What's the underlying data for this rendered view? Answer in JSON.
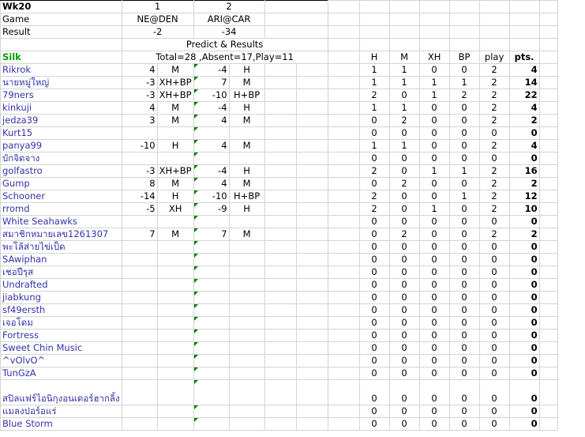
{
  "sheet": {
    "week": "Wk20",
    "labels": {
      "game": "Game",
      "result": "Result",
      "predict": "Predict & Results"
    },
    "games": [
      {
        "num": "1",
        "matchup": "NE@DEN",
        "result": "-2"
      },
      {
        "num": "2",
        "matchup": "ARI@CAR",
        "result": "-34"
      }
    ],
    "group": {
      "name": "Silk",
      "summary": "Total=28 ,Absent=17,Play=11"
    },
    "columns": [
      "H",
      "M",
      "XH",
      "BP",
      "play",
      "pts."
    ],
    "players": [
      {
        "name": "Rikrok",
        "p1": "4",
        "r1": "M",
        "p2": "-4",
        "r2": "H",
        "H": "1",
        "M": "1",
        "XH": "0",
        "BP": "0",
        "play": "2",
        "pts": "4"
      },
      {
        "name": "นายหมู่ใหญ่",
        "p1": "-3",
        "r1": "XH+BP",
        "p2": "7",
        "r2": "M",
        "H": "1",
        "M": "1",
        "XH": "1",
        "BP": "1",
        "play": "2",
        "pts": "14"
      },
      {
        "name": "79ners",
        "p1": "-3",
        "r1": "XH+BP",
        "p2": "-10",
        "r2": "H+BP",
        "H": "2",
        "M": "0",
        "XH": "1",
        "BP": "2",
        "play": "2",
        "pts": "22"
      },
      {
        "name": "kinkuji",
        "p1": "4",
        "r1": "M",
        "p2": "-4",
        "r2": "H",
        "H": "1",
        "M": "1",
        "XH": "0",
        "BP": "0",
        "play": "2",
        "pts": "4"
      },
      {
        "name": "jedza39",
        "p1": "3",
        "r1": "M",
        "p2": "4",
        "r2": "M",
        "H": "0",
        "M": "2",
        "XH": "0",
        "BP": "0",
        "play": "2",
        "pts": "2"
      },
      {
        "name": "Kurt15",
        "p1": "",
        "r1": "",
        "p2": "",
        "r2": "",
        "H": "0",
        "M": "0",
        "XH": "0",
        "BP": "0",
        "play": "0",
        "pts": "0"
      },
      {
        "name": "panya99",
        "p1": "-10",
        "r1": "H",
        "p2": "4",
        "r2": "M",
        "H": "1",
        "M": "1",
        "XH": "0",
        "BP": "0",
        "play": "2",
        "pts": "4"
      },
      {
        "name": "บักจิดจาง",
        "p1": "",
        "r1": "",
        "p2": "",
        "r2": "",
        "H": "0",
        "M": "0",
        "XH": "0",
        "BP": "0",
        "play": "0",
        "pts": "0"
      },
      {
        "name": "golfastro",
        "p1": "-3",
        "r1": "XH+BP",
        "p2": "-4",
        "r2": "H",
        "H": "2",
        "M": "0",
        "XH": "1",
        "BP": "1",
        "play": "2",
        "pts": "16"
      },
      {
        "name": "Gump",
        "p1": "8",
        "r1": "M",
        "p2": "4",
        "r2": "M",
        "H": "0",
        "M": "2",
        "XH": "0",
        "BP": "0",
        "play": "2",
        "pts": "2"
      },
      {
        "name": "Schooner",
        "p1": "-14",
        "r1": "H",
        "p2": "-10",
        "r2": "H+BP",
        "H": "2",
        "M": "0",
        "XH": "0",
        "BP": "1",
        "play": "2",
        "pts": "12"
      },
      {
        "name": "rromd",
        "p1": "-5",
        "r1": "XH",
        "p2": "-9",
        "r2": "H",
        "H": "2",
        "M": "0",
        "XH": "1",
        "BP": "0",
        "play": "2",
        "pts": "10"
      },
      {
        "name": "White Seahawks",
        "p1": "",
        "r1": "",
        "p2": "",
        "r2": "",
        "H": "0",
        "M": "0",
        "XH": "0",
        "BP": "0",
        "play": "0",
        "pts": "0"
      },
      {
        "name": "สมาชิกหมายเลข1261307",
        "p1": "7",
        "r1": "M",
        "p2": "7",
        "r2": "M",
        "H": "0",
        "M": "2",
        "XH": "0",
        "BP": "0",
        "play": "2",
        "pts": "2"
      },
      {
        "name": "พะโล้ส่ายไข่เป็ด",
        "p1": "",
        "r1": "",
        "p2": "",
        "r2": "",
        "H": "0",
        "M": "0",
        "XH": "0",
        "BP": "0",
        "play": "0",
        "pts": "0"
      },
      {
        "name": "SAwiphan",
        "p1": "",
        "r1": "",
        "p2": "",
        "r2": "",
        "H": "0",
        "M": "0",
        "XH": "0",
        "BP": "0",
        "play": "0",
        "pts": "0"
      },
      {
        "name": "เชอปีรุส",
        "p1": "",
        "r1": "",
        "p2": "",
        "r2": "",
        "H": "0",
        "M": "0",
        "XH": "0",
        "BP": "0",
        "play": "0",
        "pts": "0"
      },
      {
        "name": "Undrafted",
        "p1": "",
        "r1": "",
        "p2": "",
        "r2": "",
        "H": "0",
        "M": "0",
        "XH": "0",
        "BP": "0",
        "play": "0",
        "pts": "0"
      },
      {
        "name": "jiabkung",
        "p1": "",
        "r1": "",
        "p2": "",
        "r2": "",
        "H": "0",
        "M": "0",
        "XH": "0",
        "BP": "0",
        "play": "0",
        "pts": "0"
      },
      {
        "name": "sf49ersth",
        "p1": "",
        "r1": "",
        "p2": "",
        "r2": "",
        "H": "0",
        "M": "0",
        "XH": "0",
        "BP": "0",
        "play": "0",
        "pts": "0"
      },
      {
        "name": "เจอโดม",
        "p1": "",
        "r1": "",
        "p2": "",
        "r2": "",
        "H": "0",
        "M": "0",
        "XH": "0",
        "BP": "0",
        "play": "0",
        "pts": "0"
      },
      {
        "name": "Fortress",
        "p1": "",
        "r1": "",
        "p2": "",
        "r2": "",
        "H": "0",
        "M": "0",
        "XH": "0",
        "BP": "0",
        "play": "0",
        "pts": "0"
      },
      {
        "name": "Sweet Chin Music",
        "p1": "",
        "r1": "",
        "p2": "",
        "r2": "",
        "H": "0",
        "M": "0",
        "XH": "0",
        "BP": "0",
        "play": "0",
        "pts": "0"
      },
      {
        "name": "^vOlvO^",
        "p1": "",
        "r1": "",
        "p2": "",
        "r2": "",
        "H": "0",
        "M": "0",
        "XH": "0",
        "BP": "0",
        "play": "0",
        "pts": "0"
      },
      {
        "name": "TunGzA",
        "p1": "",
        "r1": "",
        "p2": "",
        "r2": "",
        "H": "0",
        "M": "0",
        "XH": "0",
        "BP": "0",
        "play": "0",
        "pts": "0"
      },
      {
        "name": "สปิลแฟร์ไอนิกุงอนเดอร์ฮากลิ้ง",
        "p1": "",
        "r1": "",
        "p2": "",
        "r2": "",
        "H": "0",
        "M": "0",
        "XH": "0",
        "BP": "0",
        "play": "0",
        "pts": "0",
        "tall": true
      },
      {
        "name": "แมลงปอร์อแร่",
        "p1": "",
        "r1": "",
        "p2": "",
        "r2": "",
        "H": "0",
        "M": "0",
        "XH": "0",
        "BP": "0",
        "play": "0",
        "pts": "0"
      },
      {
        "name": "Blue Storm",
        "p1": "",
        "r1": "",
        "p2": "",
        "r2": "",
        "H": "0",
        "M": "0",
        "XH": "0",
        "BP": "0",
        "play": "0",
        "pts": "0"
      }
    ],
    "colors": {
      "name": "#3333aa",
      "group": "#00a000",
      "flag": "#008000"
    }
  }
}
